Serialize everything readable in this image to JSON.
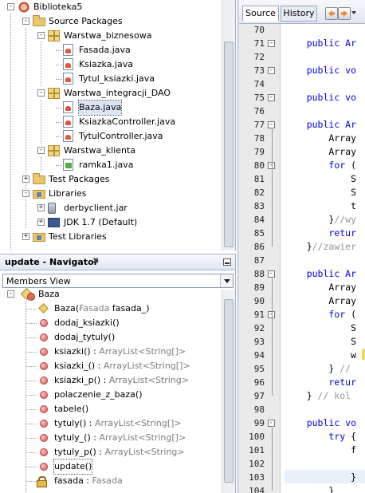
{
  "projects": {
    "tree": [
      {
        "name": "project-node",
        "icon": "project-icon",
        "label": "Biblioteka5",
        "toggle": "-"
      },
      {
        "name": "source-packages-node",
        "icon": "folder-icon",
        "label": "Source Packages",
        "toggle": "-"
      },
      {
        "name": "package-warstwa-biznesowa",
        "icon": "package-icon",
        "label": "Warstwa_biznesowa",
        "toggle": "-"
      },
      {
        "name": "file-fasada",
        "icon": "java-file-icon",
        "label": "Fasada.java"
      },
      {
        "name": "file-ksiazka",
        "icon": "java-file-icon",
        "label": "Ksiazka.java"
      },
      {
        "name": "file-tytul-ksiazki",
        "icon": "java-file-icon",
        "label": "Tytul_ksiazki.java"
      },
      {
        "name": "package-warstwa-integracji",
        "icon": "package-icon",
        "label": "Warstwa_integracji_DAO",
        "toggle": "-"
      },
      {
        "name": "file-baza",
        "icon": "java-file-icon",
        "label": "Baza.java",
        "selected": true
      },
      {
        "name": "file-ksiazka-controller",
        "icon": "java-file-icon",
        "label": "KsiazkaController.java"
      },
      {
        "name": "file-tytul-controller",
        "icon": "java-file-icon",
        "label": "TytulController.java"
      },
      {
        "name": "package-warstwa-klienta",
        "icon": "package-icon",
        "label": "Warstwa_klienta",
        "toggle": "-"
      },
      {
        "name": "file-ramka1",
        "icon": "form-file-icon",
        "label": "ramka1.java"
      },
      {
        "name": "test-packages-node",
        "icon": "folder-icon",
        "label": "Test Packages",
        "toggle": "+"
      },
      {
        "name": "libraries-node",
        "icon": "libraries-icon",
        "label": "Libraries",
        "toggle": "-"
      },
      {
        "name": "lib-derbyclient",
        "icon": "jar-icon",
        "label": "derbyclient.jar",
        "toggle": "+"
      },
      {
        "name": "lib-jdk",
        "icon": "jdk-icon",
        "label": "JDK 1.7 (Default)",
        "toggle": "+"
      },
      {
        "name": "test-libraries-node",
        "icon": "libraries-icon",
        "label": "Test Libraries",
        "toggle": "+"
      }
    ]
  },
  "navigator": {
    "title": "update - Navigator",
    "close_glyph": "✖",
    "view_combo": "Members View",
    "class_name": "Baza",
    "members": [
      {
        "kind": "constructor",
        "name": "Baza",
        "params_open": "(",
        "param_type": "Fasada",
        "param_name": " fasada_",
        "params_close": ")",
        "type": ""
      },
      {
        "kind": "method",
        "name": "dodaj_ksiazki()",
        "type": ""
      },
      {
        "kind": "method",
        "name": "dodaj_tytuly()",
        "type": ""
      },
      {
        "kind": "method",
        "name": "ksiazki() : ",
        "type": "ArrayList<String[]>"
      },
      {
        "kind": "method",
        "name": "ksiazki_() : ",
        "type": "ArrayList<String[]>"
      },
      {
        "kind": "method",
        "name": "ksiazki_p() : ",
        "type": "ArrayList<String>"
      },
      {
        "kind": "method",
        "name": "polaczenie_z_baza()",
        "type": ""
      },
      {
        "kind": "method",
        "name": "tabele()",
        "type": ""
      },
      {
        "kind": "method",
        "name": "tytuly() : ",
        "type": "ArrayList<String[]>"
      },
      {
        "kind": "method",
        "name": "tytuly_() : ",
        "type": "ArrayList<String[]>"
      },
      {
        "kind": "method",
        "name": "tytuly_p() : ",
        "type": "ArrayList<String>"
      },
      {
        "kind": "method",
        "name": "update()",
        "type": "",
        "focused": true
      },
      {
        "kind": "field",
        "name": "fasada : ",
        "type": "Fasada"
      }
    ]
  },
  "editor": {
    "tabs": {
      "source": "Source",
      "history": "History"
    },
    "lines": [
      {
        "n": "70",
        "fold": "",
        "segments": [
          {
            "t": ""
          }
        ]
      },
      {
        "n": "71",
        "fold": "-",
        "segments": [
          {
            "t": "    "
          },
          {
            "t": "public Ar",
            "c": "kw"
          }
        ]
      },
      {
        "n": "72",
        "fold": "",
        "segments": [
          {
            "t": ""
          }
        ]
      },
      {
        "n": "73",
        "fold": "-",
        "segments": [
          {
            "t": "    "
          },
          {
            "t": "public vo",
            "c": "kw"
          }
        ]
      },
      {
        "n": "74",
        "fold": "",
        "segments": [
          {
            "t": ""
          }
        ]
      },
      {
        "n": "75",
        "fold": "-",
        "segments": [
          {
            "t": "    "
          },
          {
            "t": "public vo",
            "c": "kw"
          }
        ]
      },
      {
        "n": "76",
        "fold": "",
        "segments": [
          {
            "t": ""
          }
        ]
      },
      {
        "n": "77",
        "fold": "-",
        "segments": [
          {
            "t": "    "
          },
          {
            "t": "public Ar",
            "c": "kw"
          }
        ]
      },
      {
        "n": "78",
        "fold": "",
        "segments": [
          {
            "t": "        Array"
          }
        ]
      },
      {
        "n": "79",
        "fold": "",
        "segments": [
          {
            "t": "        Array"
          }
        ]
      },
      {
        "n": "80",
        "fold": "-",
        "segments": [
          {
            "t": "        "
          },
          {
            "t": "for",
            "c": "kw"
          },
          {
            "t": " ("
          }
        ]
      },
      {
        "n": "81",
        "fold": "",
        "segments": [
          {
            "t": "            S"
          }
        ]
      },
      {
        "n": "82",
        "fold": "",
        "segments": [
          {
            "t": "            S"
          }
        ]
      },
      {
        "n": "83",
        "fold": "",
        "segments": [
          {
            "t": "            t"
          }
        ]
      },
      {
        "n": "84",
        "fold": "",
        "segments": [
          {
            "t": "        }"
          },
          {
            "t": "//wy",
            "c": "cm"
          }
        ]
      },
      {
        "n": "85",
        "fold": "",
        "segments": [
          {
            "t": "        "
          },
          {
            "t": "retur",
            "c": "kw"
          }
        ]
      },
      {
        "n": "86",
        "fold": "",
        "segments": [
          {
            "t": "    }"
          },
          {
            "t": "//zawier",
            "c": "cm"
          }
        ]
      },
      {
        "n": "87",
        "fold": "",
        "segments": [
          {
            "t": ""
          }
        ]
      },
      {
        "n": "88",
        "fold": "-",
        "segments": [
          {
            "t": "    "
          },
          {
            "t": "public Ar",
            "c": "kw"
          }
        ]
      },
      {
        "n": "89",
        "fold": "",
        "segments": [
          {
            "t": "        Array"
          }
        ]
      },
      {
        "n": "90",
        "fold": "",
        "segments": [
          {
            "t": "        Array"
          }
        ]
      },
      {
        "n": "91",
        "fold": "-",
        "segments": [
          {
            "t": "        "
          },
          {
            "t": "for",
            "c": "kw"
          },
          {
            "t": " ("
          }
        ]
      },
      {
        "n": "92",
        "fold": "",
        "segments": [
          {
            "t": "            S"
          }
        ]
      },
      {
        "n": "93",
        "fold": "",
        "segments": [
          {
            "t": "            S"
          }
        ]
      },
      {
        "n": "94",
        "fold": "",
        "segments": [
          {
            "t": "            w"
          }
        ]
      },
      {
        "n": "95",
        "fold": "",
        "segments": [
          {
            "t": "        } "
          },
          {
            "t": "//",
            "c": "cm"
          }
        ]
      },
      {
        "n": "96",
        "fold": "",
        "segments": [
          {
            "t": "        "
          },
          {
            "t": "retur",
            "c": "kw"
          }
        ]
      },
      {
        "n": "97",
        "fold": "",
        "segments": [
          {
            "t": "    } "
          },
          {
            "t": "// kol",
            "c": "cm"
          }
        ]
      },
      {
        "n": "98",
        "fold": "",
        "segments": [
          {
            "t": ""
          }
        ]
      },
      {
        "n": "99",
        "fold": "-",
        "segments": [
          {
            "t": "    "
          },
          {
            "t": "public vo",
            "c": "kw"
          }
        ]
      },
      {
        "n": "100",
        "fold": "",
        "segments": [
          {
            "t": "        "
          },
          {
            "t": "try",
            "c": "kw"
          },
          {
            "t": " {"
          }
        ]
      },
      {
        "n": "101",
        "fold": "",
        "segments": [
          {
            "t": "            f"
          }
        ]
      },
      {
        "n": "102",
        "fold": "",
        "segments": [
          {
            "t": ""
          }
        ]
      },
      {
        "n": "103",
        "fold": "",
        "segments": [
          {
            "t": "            }"
          }
        ]
      },
      {
        "n": "104",
        "fold": "",
        "segments": [
          {
            "t": "        }"
          }
        ]
      }
    ]
  },
  "colors": {
    "keyword": "#0000e6",
    "comment": "#969696",
    "selection": "#dbe5f5",
    "current_line": "#e8f0fa"
  }
}
